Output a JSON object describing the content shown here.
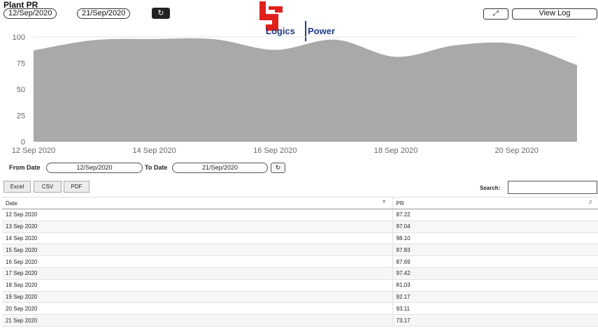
{
  "header": {
    "title": "Plant PR",
    "date_from": "12/Sep/2020",
    "date_to": "21/Sep/2020",
    "refresh_icon": "refresh-icon",
    "expand_icon": "expand-icon",
    "view_log_label": "View Log"
  },
  "logo": {
    "word_left": "Logics",
    "word_right": "Power",
    "brand_red": "#e0201c",
    "brand_blue": "#1f3b8c"
  },
  "chart_data": {
    "type": "area",
    "x": [
      "12 Sep 2020",
      "13 Sep 2020",
      "14 Sep 2020",
      "15 Sep 2020",
      "16 Sep 2020",
      "17 Sep 2020",
      "18 Sep 2020",
      "19 Sep 2020",
      "20 Sep 2020",
      "21 Sep 2020"
    ],
    "series": [
      {
        "values": [
          87.22,
          97.04,
          98.1,
          97.83,
          87.69,
          97.42,
          81.03,
          92.17,
          93.11,
          73.17
        ]
      }
    ],
    "xticks": [
      "12 Sep 2020",
      "14 Sep 2020",
      "16 Sep 2020",
      "18 Sep 2020",
      "20 Sep 2020"
    ],
    "yticks": [
      0,
      25,
      50,
      75,
      100
    ],
    "ylim": [
      0,
      100
    ],
    "grid": true,
    "fill_color": "#a9a9a9",
    "xlabel": "",
    "ylabel": "",
    "title": ""
  },
  "filter": {
    "from_label": "From Date",
    "from_value": "12/Sep/2020",
    "to_label": "To Date",
    "to_value": "21/Sep/2020"
  },
  "export": {
    "excel": "Excel",
    "csv": "CSV",
    "pdf": "PDF",
    "search_label": "Search:",
    "search_value": ""
  },
  "table": {
    "headers": [
      "Date",
      "PR"
    ],
    "rows": [
      [
        "12 Sep 2020",
        "87.22"
      ],
      [
        "13 Sep 2020",
        "97.04"
      ],
      [
        "14 Sep 2020",
        "98.10"
      ],
      [
        "15 Sep 2020",
        "97.83"
      ],
      [
        "16 Sep 2020",
        "87.69"
      ],
      [
        "17 Sep 2020",
        "97.42"
      ],
      [
        "18 Sep 2020",
        "81.03"
      ],
      [
        "19 Sep 2020",
        "92.17"
      ],
      [
        "20 Sep 2020",
        "93.11"
      ],
      [
        "21 Sep 2020",
        "73.17"
      ]
    ]
  }
}
